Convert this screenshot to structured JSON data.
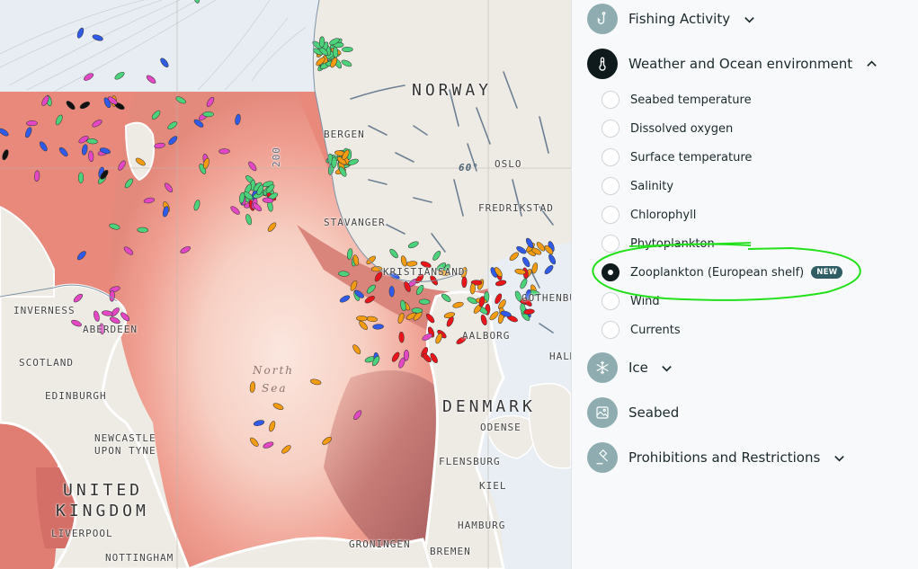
{
  "map": {
    "country_labels": [
      "NORWAY",
      "DENMARK",
      "UNITED",
      "KINGDOM"
    ],
    "city_labels": [
      "BERGEN",
      "STAVANGER",
      "OSLO",
      "FREDRIKSTAD",
      "KRISTIANSAND",
      "GOTHENBURG",
      "AALBORG",
      "HALMSTAD",
      "INVERNESS",
      "ABERDEEN",
      "SCOTLAND",
      "EDINBURGH",
      "NEWCASTLE",
      "UPON TYNE",
      "LIVERPOOL",
      "NOTTINGHAM",
      "ODENSE",
      "FLENSBURG",
      "KIEL",
      "HAMBURG",
      "GRONINGEN",
      "BREMEN"
    ],
    "sea_label_1": "North",
    "sea_label_2": "Sea",
    "depth_label": "200",
    "latitude_label": "60°",
    "layer_colors": {
      "low": "#fbe9e2",
      "mid": "#ee9a8c",
      "high": "#b36463",
      "land": "#eeebe5",
      "ice_water": "#e6ecf1"
    },
    "vessel_colors": {
      "fishing": "#4cd27a",
      "pink": "#e447c4",
      "blue": "#2f5be8",
      "red": "#e8151b",
      "orange": "#f39c12",
      "black": "#111111"
    }
  },
  "panel": {
    "categories": [
      {
        "label": "Fishing Activity",
        "icon": "fishing-hook-icon",
        "expanded": false
      },
      {
        "label": "Weather and Ocean environment",
        "icon": "thermometer-icon",
        "expanded": true
      },
      {
        "label": "Ice",
        "icon": "snowflake-icon",
        "expanded": false
      },
      {
        "label": "Seabed",
        "icon": "image-landscape-icon",
        "expanded": null
      },
      {
        "label": "Prohibitions and Restrictions",
        "icon": "gavel-icon",
        "expanded": false
      }
    ],
    "weather_options": [
      {
        "label": "Seabed temperature",
        "selected": false
      },
      {
        "label": "Dissolved oxygen",
        "selected": false
      },
      {
        "label": "Surface temperature",
        "selected": false
      },
      {
        "label": "Salinity",
        "selected": false
      },
      {
        "label": "Chlorophyll",
        "selected": false
      },
      {
        "label": "Phytoplankton",
        "selected": false
      },
      {
        "label": "Zooplankton (European shelf)",
        "selected": true,
        "badge": "NEW"
      },
      {
        "label": "Wind",
        "selected": false
      },
      {
        "label": "Currents",
        "selected": false
      }
    ],
    "accent_color": "#0e1a1c",
    "badge_color": "#2f5d63",
    "annotation_color": "#22e01a"
  }
}
